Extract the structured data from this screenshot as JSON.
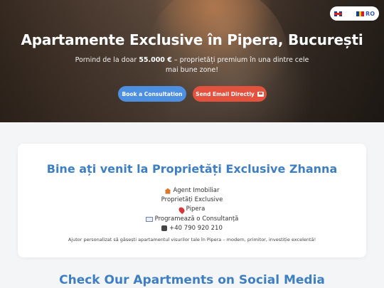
{
  "hero": {
    "title": "Apartamente Exclusive în Pipera, București",
    "subtitle_prefix": "Pornind de la doar ",
    "subtitle_price": "55.000 €",
    "subtitle_suffix": " – proprietăți premium în una dintre cele mai bune zone!",
    "consult_button": "Book a Consultation",
    "email_button": "Send Email Directly"
  },
  "language": {
    "english_flag_icon": "uk-flag-icon",
    "romanian_flag_icon": "romania-flag-icon",
    "current_label": "RO",
    "romania_colors": [
      "#0b3fa6",
      "#f5c400",
      "#cc1f2d"
    ]
  },
  "welcome": {
    "title": "Bine ați venit la Proprietăți Exclusive Zhanna",
    "lines": [
      {
        "icon": "house-icon",
        "text": "Agent Imobiliar"
      },
      {
        "icon": "",
        "text": "Proprietăți Exclusive"
      },
      {
        "icon": "pin-icon",
        "text": "Pipera"
      },
      {
        "icon": "mail-icon",
        "text": "Programează o Consultanță"
      },
      {
        "icon": "phone-icon",
        "text": "+40 790 920 210"
      }
    ],
    "description": "Ajutor personalizat să găsești apartamentul visurilor tale în Pipera – modern, primitor, investiție excelentă!"
  },
  "social": {
    "title": "Check Our Apartments on Social Media"
  },
  "colors": {
    "accent_blue": "#3d7fc2",
    "consult_button": "#4d8fe0",
    "email_button": "#e2523f"
  }
}
